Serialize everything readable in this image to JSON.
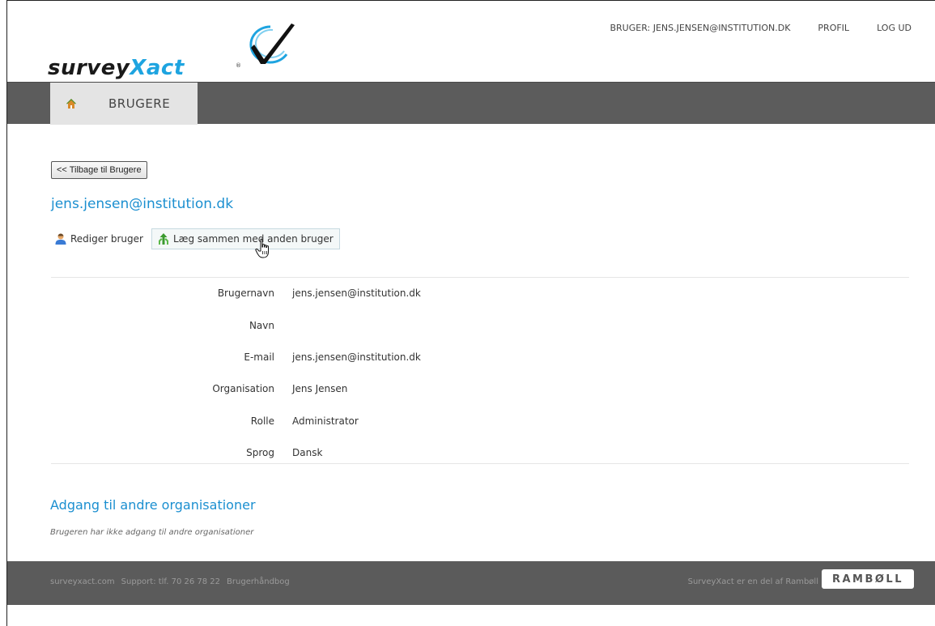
{
  "brand": {
    "word_prefix": "survey",
    "word_accent": "Xact",
    "registered": "®",
    "accent_color": "#1ea4e0"
  },
  "toplinks": {
    "user": "BRUGER: JENS.JENSEN@INSTITUTION.DK",
    "profile": "PROFIL",
    "logout": "LOG UD"
  },
  "nav": {
    "home_icon": "home-icon",
    "active_tab": "BRUGERE"
  },
  "main": {
    "back_button": "<< Tilbage til Brugere",
    "user_title": "jens.jensen@institution.dk",
    "actions": {
      "edit_user": "Rediger bruger",
      "merge_user": "Læg sammen med anden bruger"
    },
    "details": [
      {
        "label": "Brugernavn",
        "value": "jens.jensen@institution.dk"
      },
      {
        "label": "Navn",
        "value": ""
      },
      {
        "label": "E-mail",
        "value": "jens.jensen@institution.dk"
      },
      {
        "label": "Organisation",
        "value": "Jens Jensen"
      },
      {
        "label": "Rolle",
        "value": "Administrator"
      },
      {
        "label": "Sprog",
        "value": "Dansk"
      }
    ],
    "other_orgs_title": "Adgang til andre organisationer",
    "other_orgs_note": "Brugeren har ikke adgang til andre organisationer"
  },
  "footer": {
    "site": "surveyxact.com",
    "support": "Support: tlf. 70 26 78 22",
    "manual": "Brugerhåndbog",
    "part_of": "SurveyXact er en del af Rambøll",
    "partner_logo": "RAMBØLL"
  },
  "colors": {
    "link_blue": "#1b8fd0",
    "nav_bg": "#5c5c5c",
    "footer_bg": "#5b5b5b"
  }
}
